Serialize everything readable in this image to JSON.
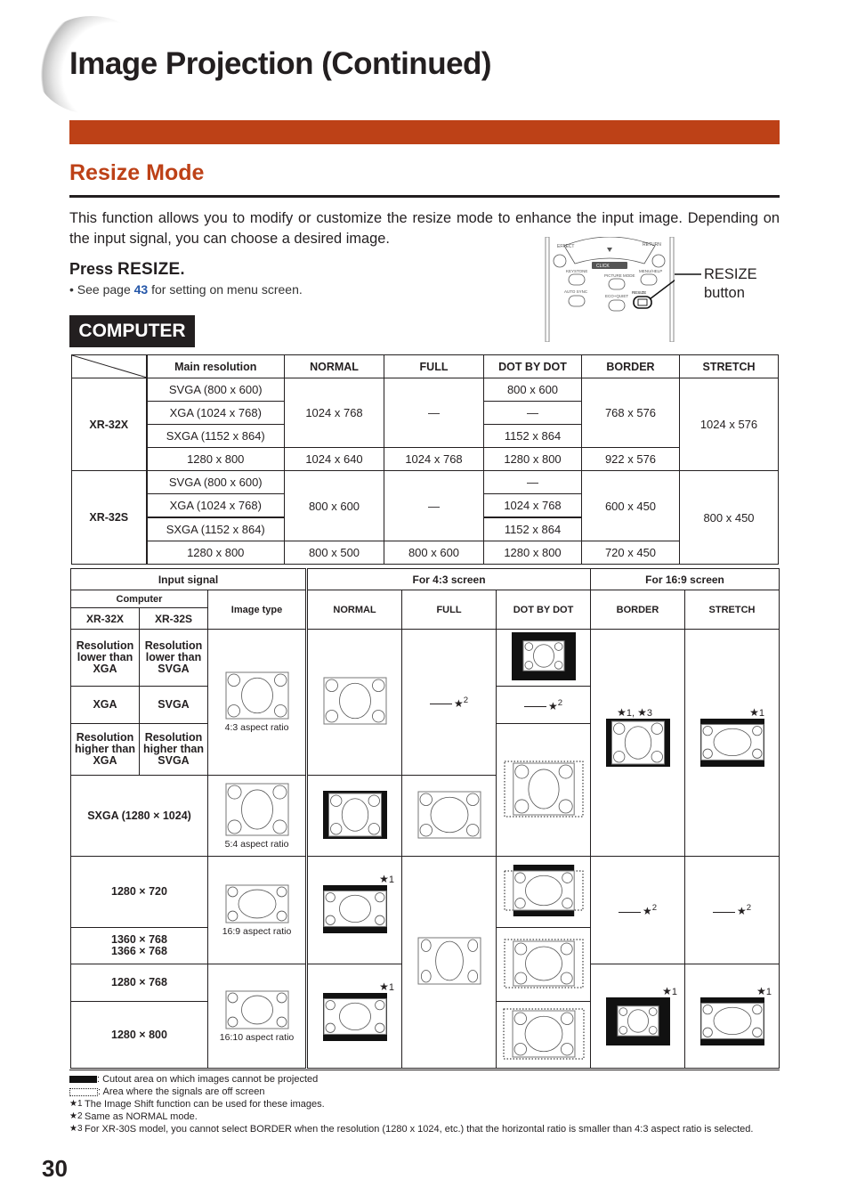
{
  "header": {
    "title": "Image Projection (Continued)",
    "accent_color": "#bd4117"
  },
  "section": {
    "title": "Resize Mode",
    "intro": "This function allows you to modify or customize the resize mode to enhance the input image. Depending on the input signal, you can choose a desired image.",
    "press_prefix": "Press ",
    "press_key": "RESIZE",
    "press_suffix": ".",
    "bullet_prefix": "• See page ",
    "bullet_page": "43",
    "bullet_suffix": " for setting on menu screen.",
    "badge": "COMPUTER"
  },
  "remote": {
    "labels": [
      "EFFECT",
      "RETURN",
      "KEYSTONE",
      "CLICK",
      "PICTURE MODE",
      "MENU/HELP",
      "AUTO SYNC",
      "ECO+QUIET",
      "RESIZE"
    ],
    "callout_line1": "RESIZE",
    "callout_line2": "button"
  },
  "resolution_table": {
    "headers": [
      "Main resolution",
      "NORMAL",
      "FULL",
      "DOT BY DOT",
      "BORDER",
      "STRETCH"
    ],
    "models": [
      {
        "name": "XR-32X",
        "rows": [
          {
            "main": "SVGA (800 x 600)",
            "dot": "800 x 600"
          },
          {
            "main": "XGA (1024 x 768)",
            "dot": "—"
          },
          {
            "main": "SXGA (1152 x 864)",
            "dot": "1152 x 864"
          },
          {
            "main": "1280 x 800",
            "normal": "1024 x 640",
            "full": "1024 x 768",
            "dot": "1280 x 800",
            "border": "922 x 576"
          }
        ],
        "group_normal": "1024 x 768",
        "group_full": "—",
        "group_border": "768 x 576",
        "stretch": "1024 x 576"
      },
      {
        "name": "XR-32S",
        "rows": [
          {
            "main": "SVGA (800 x 600)",
            "dot": "—"
          },
          {
            "main": "XGA (1024 x 768)",
            "dot": "1024 x 768"
          },
          {
            "main": "SXGA (1152 x 864)",
            "dot": "1152 x 864"
          },
          {
            "main": "1280 x 800",
            "normal": "800 x 500",
            "full": "800 x 600",
            "dot": "1280 x 800",
            "border": "720 x 450"
          }
        ],
        "group_normal": "800 x 600",
        "group_full": "—",
        "group_border": "600 x 450",
        "stretch": "800 x 450"
      }
    ]
  },
  "mode_table": {
    "input_signal": "Input signal",
    "for43": "For 4:3 screen",
    "for169": "For 16:9 screen",
    "computer": "Computer",
    "xr32x": "XR-32X",
    "xr32s": "XR-32S",
    "image_type": "Image type",
    "modes": [
      "NORMAL",
      "FULL",
      "DOT BY DOT",
      "BORDER",
      "STRETCH"
    ],
    "rows": {
      "low_x": "Resolution lower than XGA",
      "low_s": "Resolution lower than SVGA",
      "mid_x": "XGA",
      "mid_s": "SVGA",
      "high_x": "Resolution higher than XGA",
      "high_s": "Resolution higher than SVGA",
      "sxga": "SXGA (1280 × 1024)",
      "r720": "1280 × 720",
      "r768a": "1360 × 768",
      "r768b": "1366 × 768",
      "r1280_768": "1280 × 768",
      "r1280_800": "1280 × 800"
    },
    "captions": {
      "r43": "4:3 aspect ratio",
      "r54": "5:4 aspect ratio",
      "r169": "16:9 aspect ratio",
      "r1610": "16:10 aspect ratio"
    },
    "notes": {
      "n1": "1",
      "n2": "2",
      "n13": "1, ",
      "n3": "3",
      "star": "★"
    }
  },
  "legend": {
    "cutout": ": Cutout area on which images cannot be projected",
    "offscreen": ": Area where the signals are off screen",
    "fn1_mark": "★1",
    "fn1": "The Image Shift function can be used for these images.",
    "fn2_mark": "★2",
    "fn2": "Same as NORMAL mode.",
    "fn3_mark": "★3",
    "fn3": "For XR-30S model, you cannot select BORDER when the resolution (1280 x 1024, etc.) that the horizontal ratio is smaller than 4:3 aspect ratio is selected."
  },
  "page_number": "30"
}
